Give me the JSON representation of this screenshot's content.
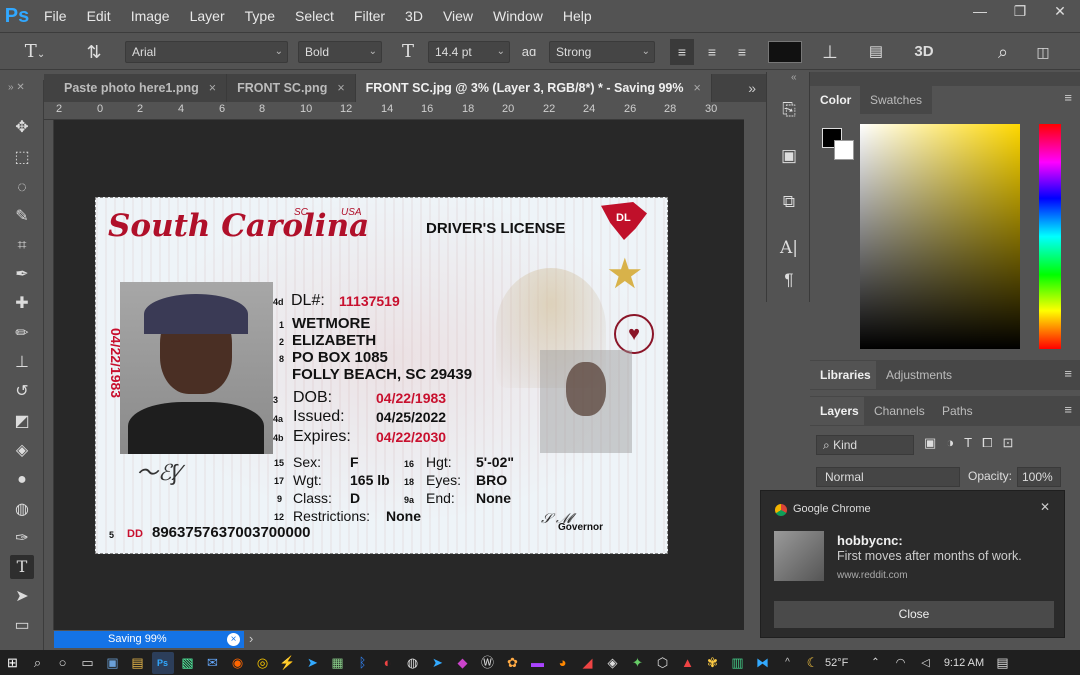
{
  "app": {
    "logo": "Ps"
  },
  "menu": [
    "File",
    "Edit",
    "Image",
    "Layer",
    "Type",
    "Select",
    "Filter",
    "3D",
    "View",
    "Window",
    "Help"
  ],
  "window_controls": {
    "minimize": "—",
    "restore": "❐",
    "close": "✕"
  },
  "options_bar": {
    "font_family": "Arial",
    "font_style": "Bold",
    "font_size": "14.4 pt",
    "antialias_label": "aɑ",
    "antialias": "Strong",
    "threed_label": "3D"
  },
  "tabs": [
    {
      "label": "Paste photo here1.png",
      "active": false
    },
    {
      "label": "FRONT SC.png",
      "active": false
    },
    {
      "label": "FRONT SC.jpg @ 3% (Layer 3, RGB/8*) * - Saving 99%",
      "active": true
    }
  ],
  "tab_close": "×",
  "tabs_overflow": "»",
  "ruler_labels": [
    "2",
    "0",
    "2",
    "4",
    "6",
    "8",
    "10",
    "12",
    "14",
    "16",
    "18",
    "20",
    "22",
    "24",
    "26",
    "28",
    "30"
  ],
  "status": {
    "progress_text": "Saving 99%",
    "progress_fraction": 0.99,
    "cancel": "×",
    "arrow": "›"
  },
  "license": {
    "state": "South Carolina",
    "sc": "SC",
    "usa": "USA",
    "title": "DRIVER'S LICENSE",
    "dl_badge": "DL",
    "side_dob": "04/22/1983",
    "field_dl_num": "4d",
    "dl_label": "DL#:",
    "dl_value": "11137519",
    "n1": "1",
    "last_name": "WETMORE",
    "n2": "2",
    "first_name": "ELIZABETH",
    "n8": "8",
    "addr1": "PO BOX 1085",
    "addr2": "FOLLY BEACH, SC 29439",
    "n3": "3",
    "dob_label": "DOB:",
    "dob": "04/22/1983",
    "n4a": "4a",
    "issued_label": "Issued:",
    "issued": "04/25/2022",
    "n4b": "4b",
    "expires_label": "Expires:",
    "expires": "04/22/2030",
    "n15": "15",
    "sex_label": "Sex:",
    "sex": "F",
    "n16": "16",
    "hgt_label": "Hgt:",
    "hgt": "5'-02\"",
    "n17": "17",
    "wgt_label": "Wgt:",
    "wgt": "165 lb",
    "n18": "18",
    "eyes_label": "Eyes:",
    "eyes": "BRO",
    "n9": "9",
    "class_label": "Class:",
    "class": "D",
    "n9a": "9a",
    "end_label": "End:",
    "end": "None",
    "n12": "12",
    "restr_label": "Restrictions:",
    "restr": "None",
    "n5": "5",
    "dd_label": "DD",
    "dd": "8963757637003700000",
    "governor": "Governor"
  },
  "panels": {
    "color_tabs": [
      "Color",
      "Swatches"
    ],
    "lib_tabs": [
      "Libraries",
      "Adjustments"
    ],
    "layer_tabs": [
      "Layers",
      "Channels",
      "Paths"
    ],
    "kind": "Kind",
    "blend": "Normal",
    "opacity_label": "Opacity:",
    "opacity": "100%",
    "menu_icon": "≡",
    "collapse": "«"
  },
  "notification": {
    "app": "Google Chrome",
    "title": "hobbycnc:",
    "body": "First moves after months of work.",
    "source": "www.reddit.com",
    "close_label": "Close",
    "dismiss": "✕"
  },
  "taskbar": {
    "weather": "52°F",
    "time": "9:12 AM"
  }
}
